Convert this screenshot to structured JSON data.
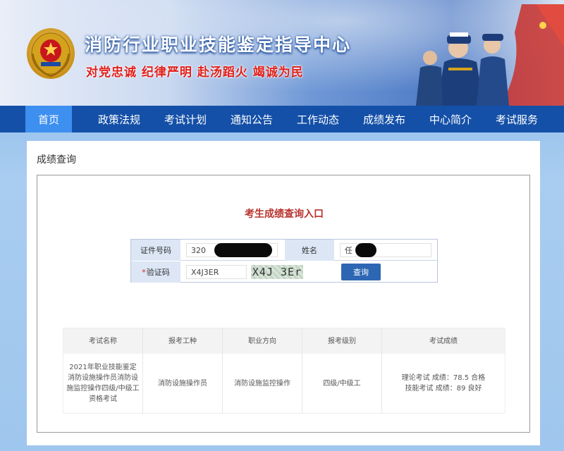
{
  "header": {
    "site_title": "消防行业职业技能鉴定指导中心",
    "slogan": "对党忠诚 纪律严明 赴汤蹈火 竭诚为民"
  },
  "nav": {
    "items": [
      {
        "label": "首页",
        "active": true
      },
      {
        "label": "政策法规"
      },
      {
        "label": "考试计划"
      },
      {
        "label": "通知公告"
      },
      {
        "label": "工作动态"
      },
      {
        "label": "成绩发布"
      },
      {
        "label": "中心简介"
      },
      {
        "label": "考试服务"
      }
    ]
  },
  "panel": {
    "title": "成绩查询",
    "section_title": "考生成绩查询入口",
    "form": {
      "id_label": "证件号码",
      "id_value": "320",
      "name_label": "姓名",
      "name_value": "任",
      "captcha_label": "验证码",
      "captcha_required_mark": "*",
      "captcha_input": "X4J3ER",
      "captcha_image_text": "X4J 3Er",
      "submit_label": "查询"
    },
    "table": {
      "headers": [
        "考试名称",
        "报考工种",
        "职业方向",
        "报考级别",
        "考试成绩"
      ],
      "rows": [
        {
          "exam_name": "2021年职业技能鉴定消防设施操作员消防设施监控操作四级/中级工资格考试",
          "job_type": "消防设施操作员",
          "direction": "消防设施监控操作",
          "level": "四级/中级工",
          "score_theory": "理论考试 成绩：78.5 合格",
          "score_skill": "技能考试 成绩：89 良好"
        }
      ]
    }
  },
  "colors": {
    "nav_bg": "#1450a8",
    "nav_active": "#3d8ff0",
    "section_title": "#b8322d",
    "button": "#2d67b4",
    "slogan": "#e0201b"
  }
}
